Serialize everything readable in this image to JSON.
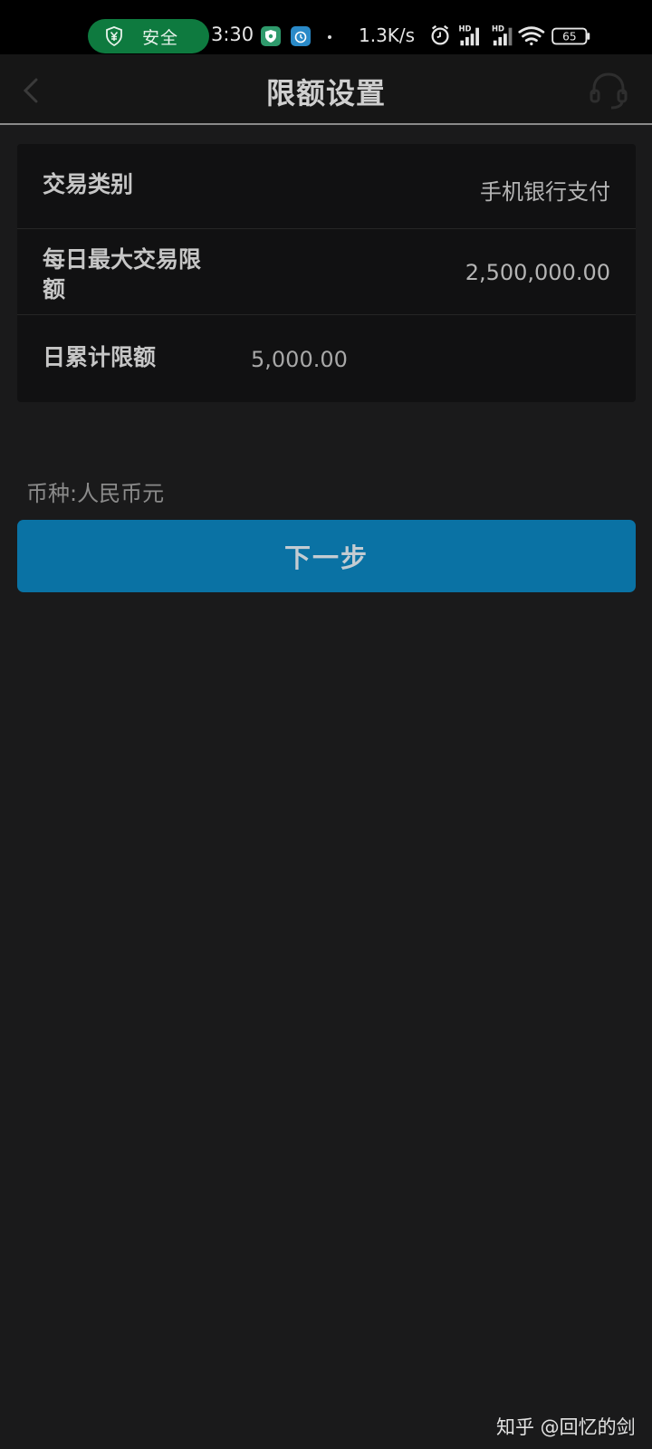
{
  "status_bar": {
    "security_label": "安全",
    "time": "3:30",
    "net_speed": "1.3K/s",
    "battery": "65",
    "icons": [
      "yen-shield-icon",
      "shield-app-icon",
      "alarm-app-icon",
      "alarm-clock-icon",
      "signal-hd-icon",
      "signal-hd-icon",
      "wifi-icon",
      "battery-icon"
    ]
  },
  "header": {
    "title": "限额设置",
    "back_icon": "chevron-left-icon",
    "service_icon": "headset-icon"
  },
  "form": {
    "rows": [
      {
        "label": "交易类别",
        "value": "手机银行支付"
      },
      {
        "label": "每日最大交易限额",
        "value": "2,500,000.00"
      },
      {
        "label": "日累计限额",
        "value": "5,000.00"
      }
    ]
  },
  "currency_note": "币种:人民币元",
  "next_button": "下一步",
  "watermark": "知乎 @回忆的剑",
  "colors": {
    "background": "#1a1a1b",
    "card": "#111112",
    "primary_button": "#0a72a4",
    "security_pill": "#0e7a3f"
  }
}
